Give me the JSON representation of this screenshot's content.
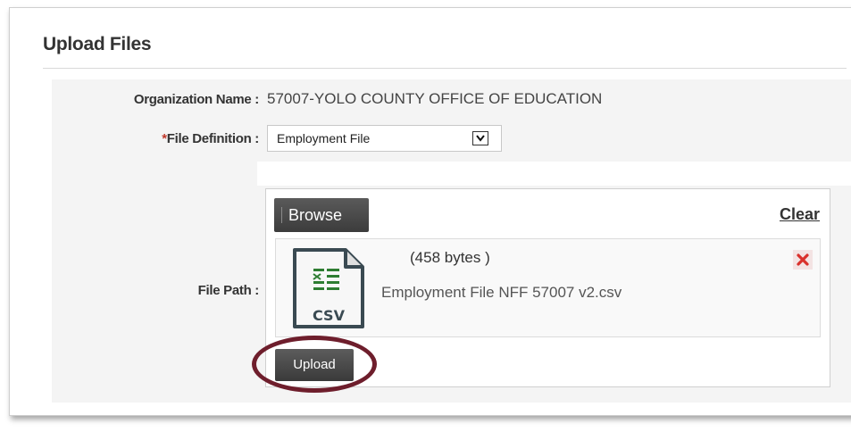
{
  "panel": {
    "title": "Upload Files"
  },
  "form": {
    "org_label": "Organization Name :",
    "org_value": "57007-YOLO COUNTY OFFICE OF EDUCATION",
    "filedef_required_mark": "*",
    "filedef_label": "File Definition :",
    "filedef_selected": "Employment File",
    "filepath_label": "File Path :"
  },
  "uploader": {
    "browse_label": "Browse",
    "clear_label": "Clear",
    "file": {
      "type_label": "CSV",
      "size": "(458 bytes )",
      "name": "Employment File NFF 57007 v2.csv"
    },
    "upload_label": "Upload"
  },
  "colors": {
    "highlight_ring": "#6e1e2c",
    "required_mark": "#c0392b",
    "remove_icon": "#d9302b",
    "csv_icon_green": "#2e7d32"
  },
  "icons": {
    "select_arrow": "chevron-down-icon",
    "file": "csv-file-icon",
    "remove": "close-icon"
  }
}
